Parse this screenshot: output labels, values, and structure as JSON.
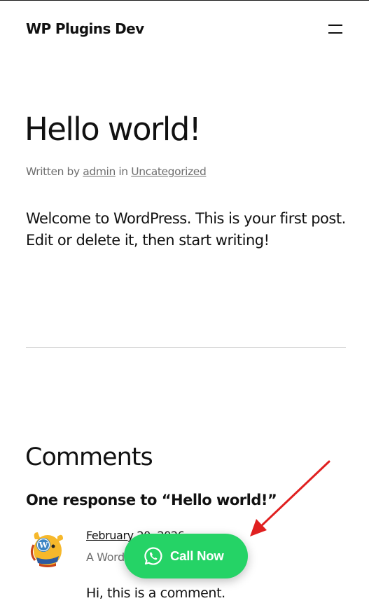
{
  "site": {
    "title": "WP Plugins Dev"
  },
  "header": {
    "menu_icon": "hamburger-menu-icon"
  },
  "post": {
    "title": "Hello world!",
    "meta_prefix": "Written by ",
    "author": "admin",
    "meta_in": " in ",
    "category": "Uncategorized",
    "content": "Welcome to WordPress. This is your first post. Edit or delete it, then start writing!"
  },
  "comments": {
    "heading": "Comments",
    "responses_title": "One response to “Hello world!”",
    "items": [
      {
        "avatar_icon": "wapuu-avatar-icon",
        "date": "February 20, 2026",
        "author_line": "A WordPress Commenter",
        "text": "Hi, this is a comment."
      }
    ]
  },
  "call_button": {
    "label": "Call Now",
    "icon": "whatsapp-icon",
    "color": "#25d366"
  },
  "annotation": {
    "arrow_color": "#e02020"
  }
}
